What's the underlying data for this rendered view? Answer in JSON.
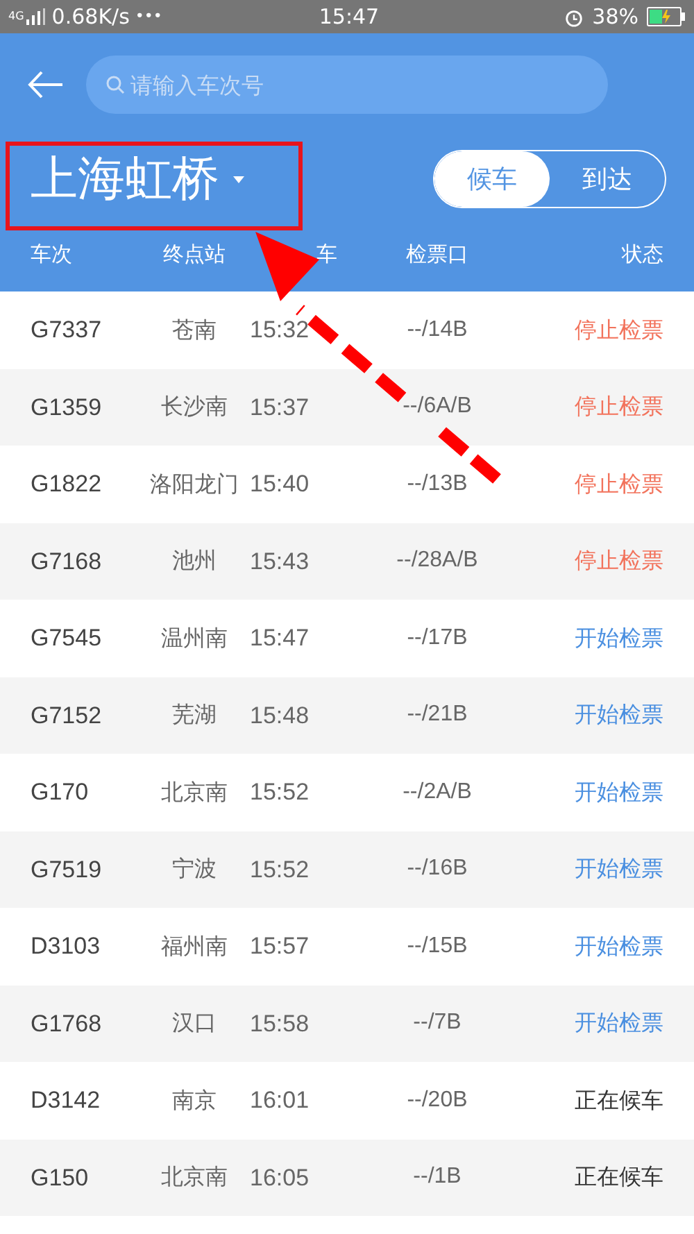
{
  "status_bar": {
    "network": "4G",
    "speed": "0.68K/s",
    "more": "•••",
    "time": "15:47",
    "battery": "38%"
  },
  "search": {
    "placeholder": "请输入车次号"
  },
  "station": {
    "name": "上海虹桥"
  },
  "mode_tabs": [
    {
      "label": "候车",
      "selected": true
    },
    {
      "label": "到达",
      "selected": false
    }
  ],
  "table": {
    "columns": [
      "车次",
      "终点站",
      "车",
      "检票口",
      "状态"
    ],
    "rows": [
      {
        "train": "G7337",
        "destination": "苍南",
        "time": "15:32",
        "gate": "--/14B",
        "status": "停止检票",
        "kind": "stopped"
      },
      {
        "train": "G1359",
        "destination": "长沙南",
        "time": "15:37",
        "gate": "--/6A/B",
        "status": "停止检票",
        "kind": "stopped"
      },
      {
        "train": "G1822",
        "destination": "洛阳龙门",
        "time": "15:40",
        "gate": "--/13B",
        "status": "停止检票",
        "kind": "stopped"
      },
      {
        "train": "G7168",
        "destination": "池州",
        "time": "15:43",
        "gate": "--/28A/B",
        "status": "停止检票",
        "kind": "stopped"
      },
      {
        "train": "G7545",
        "destination": "温州南",
        "time": "15:47",
        "gate": "--/17B",
        "status": "开始检票",
        "kind": "boarding"
      },
      {
        "train": "G7152",
        "destination": "芜湖",
        "time": "15:48",
        "gate": "--/21B",
        "status": "开始检票",
        "kind": "boarding"
      },
      {
        "train": "G170",
        "destination": "北京南",
        "time": "15:52",
        "gate": "--/2A/B",
        "status": "开始检票",
        "kind": "boarding"
      },
      {
        "train": "G7519",
        "destination": "宁波",
        "time": "15:52",
        "gate": "--/16B",
        "status": "开始检票",
        "kind": "boarding"
      },
      {
        "train": "D3103",
        "destination": "福州南",
        "time": "15:57",
        "gate": "--/15B",
        "status": "开始检票",
        "kind": "boarding"
      },
      {
        "train": "G1768",
        "destination": "汉口",
        "time": "15:58",
        "gate": "--/7B",
        "status": "开始检票",
        "kind": "boarding"
      },
      {
        "train": "D3142",
        "destination": "南京",
        "time": "16:01",
        "gate": "--/20B",
        "status": "正在候车",
        "kind": "waiting"
      },
      {
        "train": "G150",
        "destination": "北京南",
        "time": "16:05",
        "gate": "--/1B",
        "status": "正在候车",
        "kind": "waiting"
      }
    ]
  }
}
